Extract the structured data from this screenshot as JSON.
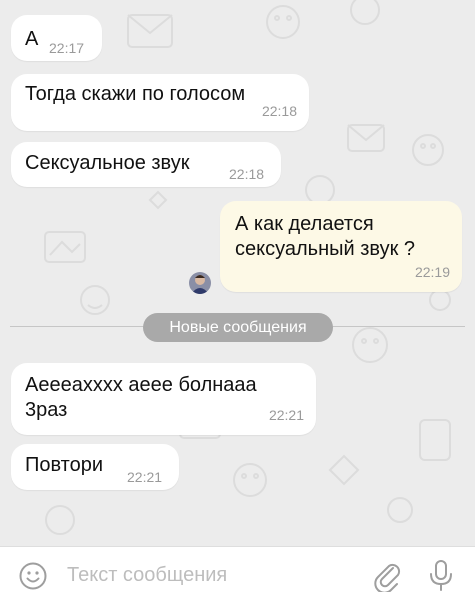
{
  "messages": [
    {
      "text": "А",
      "time": "22:17",
      "direction": "incoming"
    },
    {
      "text": "Тогда скажи по голосом",
      "time": "22:18",
      "direction": "incoming"
    },
    {
      "text": "Сексуальное звук",
      "time": "22:18",
      "direction": "incoming"
    },
    {
      "text": "А как делается\nсексуальный звук ?",
      "time": "22:19",
      "direction": "outgoing"
    },
    {
      "text": "Аееeaxxxx аеее болнааа\n3раз",
      "time": "22:21",
      "direction": "incoming"
    },
    {
      "text": "Повтори",
      "time": "22:21",
      "direction": "incoming"
    }
  ],
  "new_messages_label": "Новые сообщения",
  "input": {
    "placeholder": "Текст сообщения"
  },
  "icons": {
    "emoji": "emoji-icon",
    "attach": "paperclip-icon",
    "voice": "microphone-icon"
  },
  "colors": {
    "background": "#ececec",
    "incoming_bubble": "#ffffff",
    "outgoing_bubble": "#fdf9e6",
    "time": "#9a9a9a",
    "divider_pill": "#a9a9a9"
  }
}
